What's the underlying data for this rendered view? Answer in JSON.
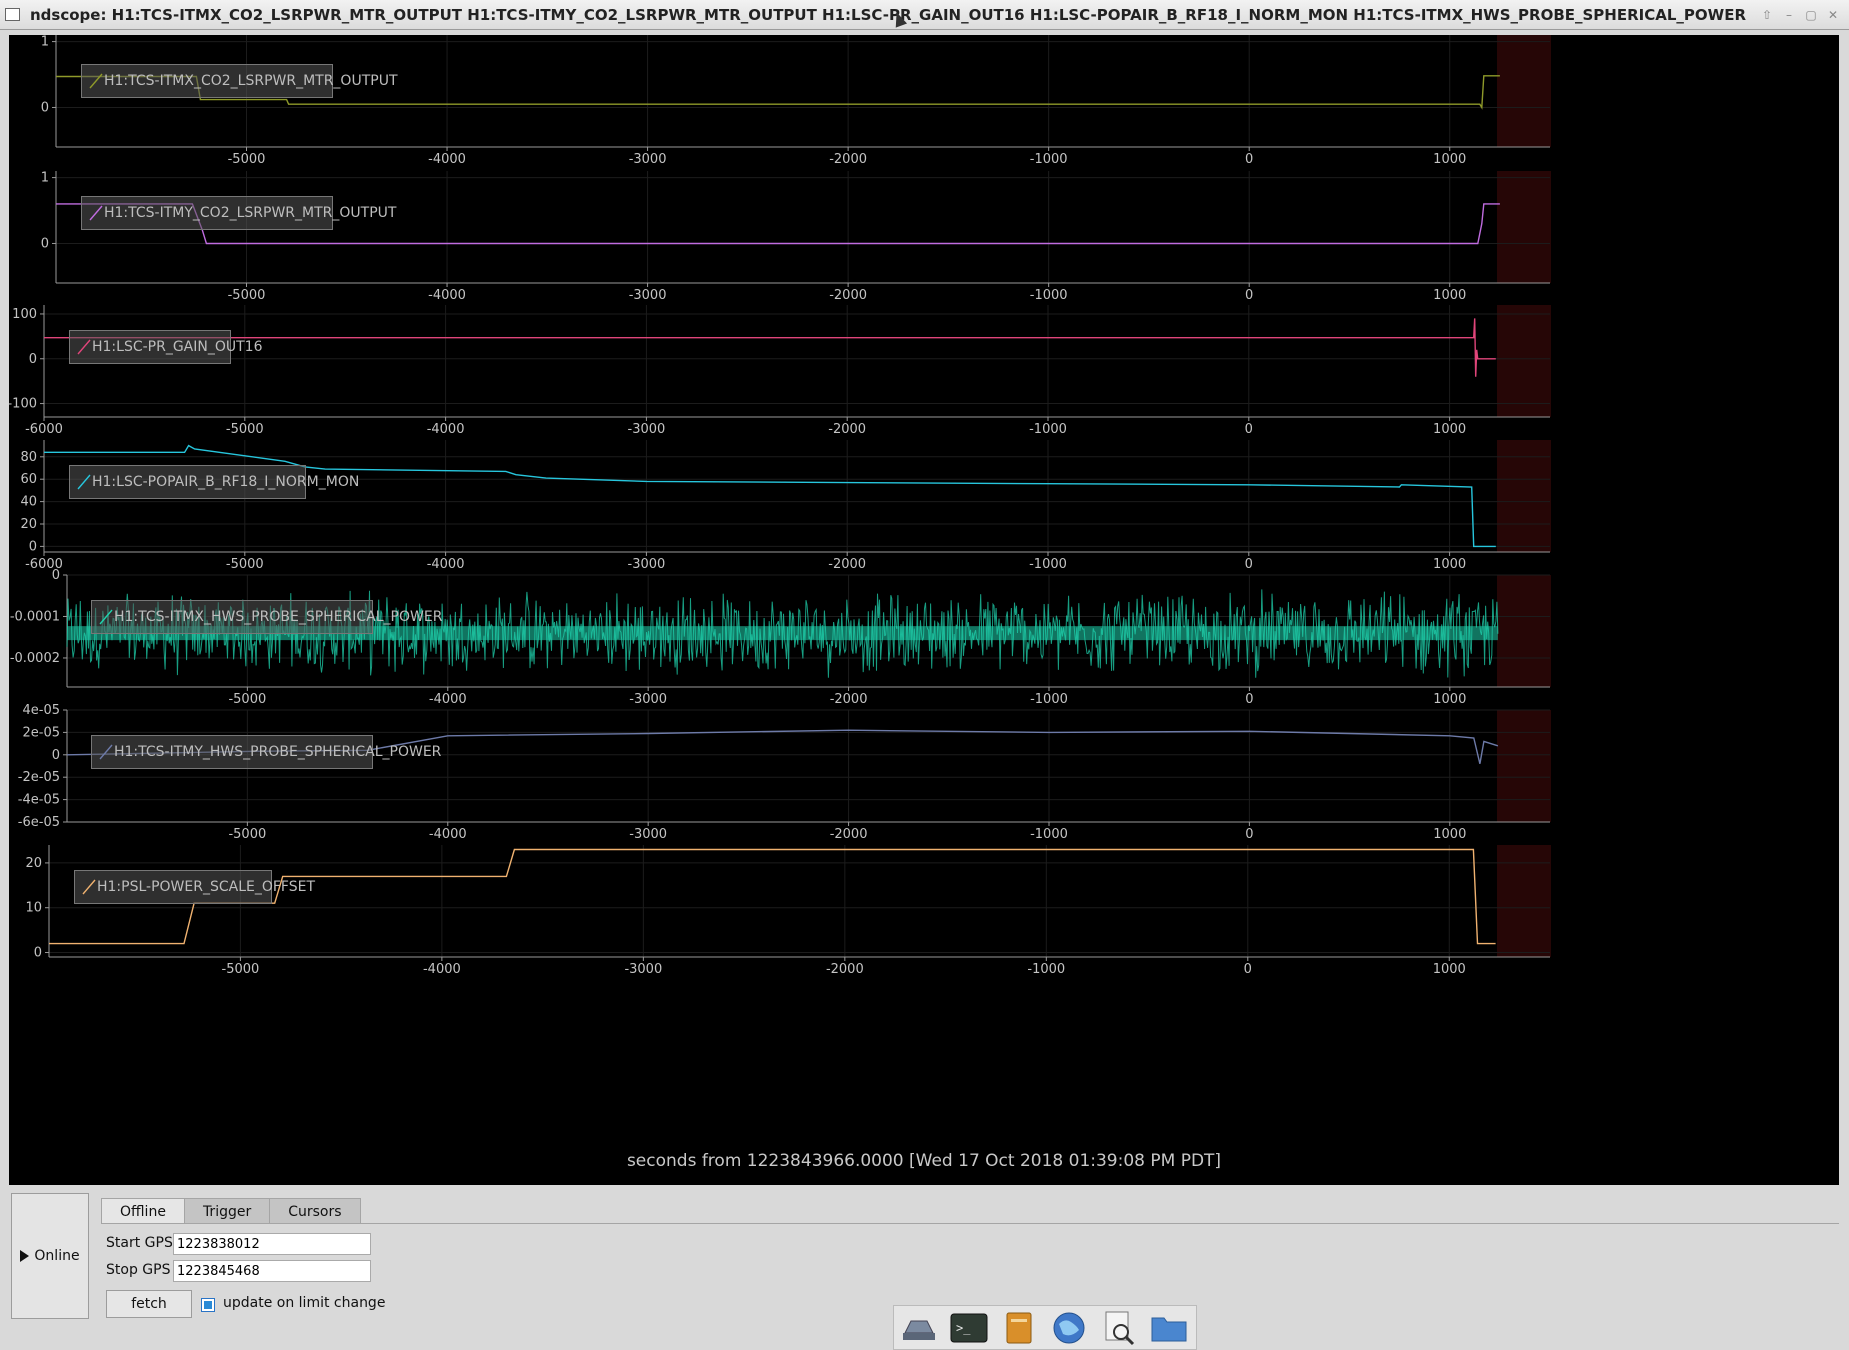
{
  "window": {
    "title": "ndscope: H1:TCS-ITMX_CO2_LSRPWR_MTR_OUTPUT H1:TCS-ITMY_CO2_LSRPWR_MTR_OUTPUT H1:LSC-PR_GAIN_OUT16 H1:LSC-POPAIR_B_RF18_I_NORM_MON H1:TCS-ITMX_HWS_PROBE_SPHERICAL_POWER H1:TCS-ITMY_HWS_PROBE_SPHERICAL_POWER H1:PSL-POWER_SCALE_OFFSET",
    "buttons": [
      "⇧",
      "–",
      "▢",
      "✕"
    ]
  },
  "plot": {
    "x_caption": "seconds from 1223843966.0000 [Wed 17 Oct 2018 01:39:08 PM PDT]"
  },
  "chart_data": [
    {
      "type": "line",
      "series": [
        {
          "name": "H1:TCS-ITMX_CO2_LSRPWR_MTR_OUTPUT",
          "color": "#8f9a2a",
          "x": [
            -5950,
            -5250,
            -5230,
            -4800,
            -4790,
            1150,
            1160,
            1170,
            1230,
            1250
          ],
          "y": [
            0.47,
            0.47,
            0.12,
            0.12,
            0.05,
            0.05,
            0.0,
            0.48,
            0.48,
            0.48
          ]
        }
      ],
      "y_ticks": [
        "1",
        "0"
      ],
      "x_ticks": [
        "-5000",
        "-4000",
        "-3000",
        "-2000",
        "-1000",
        "0",
        "1000"
      ],
      "ylim": [
        -0.6,
        1.1
      ],
      "xlim": [
        -5950,
        1500
      ]
    },
    {
      "type": "line",
      "series": [
        {
          "name": "H1:TCS-ITMY_CO2_LSRPWR_MTR_OUTPUT",
          "color": "#c06ce0",
          "x": [
            -5950,
            -5270,
            -5220,
            -5200,
            1140,
            1160,
            1170,
            1250
          ],
          "y": [
            0.6,
            0.6,
            0.2,
            0.0,
            0.0,
            0.3,
            0.6,
            0.6
          ]
        }
      ],
      "y_ticks": [
        "1",
        "0"
      ],
      "x_ticks": [
        "-5000",
        "-4000",
        "-3000",
        "-2000",
        "-1000",
        "0",
        "1000"
      ],
      "ylim": [
        -0.6,
        1.1
      ],
      "xlim": [
        -5950,
        1500
      ]
    },
    {
      "type": "line",
      "series": [
        {
          "name": "H1:LSC-PR_GAIN_OUT16",
          "color": "#e0457a",
          "x": [
            -6000,
            1120,
            1125,
            1130,
            1135,
            1140,
            1150,
            1230
          ],
          "y": [
            47,
            47,
            90,
            -40,
            20,
            0,
            0,
            0
          ]
        }
      ],
      "y_ticks": [
        "100",
        "0",
        "-100"
      ],
      "x_ticks": [
        "-6000",
        "-5000",
        "-4000",
        "-3000",
        "-2000",
        "-1000",
        "0",
        "1000"
      ],
      "ylim": [
        -130,
        120
      ],
      "xlim": [
        -6000,
        1500
      ]
    },
    {
      "type": "line",
      "series": [
        {
          "name": "H1:LSC-POPAIR_B_RF18_I_NORM_MON",
          "color": "#27c6dd",
          "x": [
            -6000,
            -5300,
            -5280,
            -5250,
            -4800,
            -4700,
            -4600,
            -3700,
            -3650,
            -3500,
            -3000,
            -2000,
            -1000,
            0,
            750,
            760,
            1110,
            1120,
            1230
          ],
          "y": [
            84,
            84,
            90,
            87,
            76,
            71,
            69,
            67,
            64,
            61,
            58,
            57,
            56,
            55,
            53,
            55,
            53,
            0,
            0
          ]
        }
      ],
      "y_ticks": [
        "80",
        "60",
        "40",
        "20",
        "0"
      ],
      "x_ticks": [
        "-6000",
        "-5000",
        "-4000",
        "-3000",
        "-2000",
        "-1000",
        "0",
        "1000"
      ],
      "ylim": [
        -5,
        95
      ],
      "xlim": [
        -6000,
        1500
      ]
    },
    {
      "type": "line",
      "series": [
        {
          "name": "H1:TCS-ITMX_HWS_PROBE_SPHERICAL_POWER",
          "color": "#1fd3ae",
          "x": [
            -5900,
            1240
          ],
          "y_center": -0.00014,
          "y_noise": 0.00011
        }
      ],
      "y_ticks": [
        "0",
        "-0.0001",
        "-0.0002"
      ],
      "x_ticks": [
        "-5000",
        "-4000",
        "-3000",
        "-2000",
        "-1000",
        "0",
        "1000"
      ],
      "ylim": [
        -0.00027,
        0.0
      ],
      "xlim": [
        -5900,
        1500
      ]
    },
    {
      "type": "line",
      "series": [
        {
          "name": "H1:TCS-ITMY_HWS_PROBE_SPHERICAL_POWER",
          "color": "#6d7aa8",
          "x": [
            -5900,
            -5000,
            -4400,
            -4000,
            -3000,
            -2000,
            -1000,
            0,
            1000,
            1120,
            1150,
            1170,
            1240
          ],
          "y": [
            0.0,
            3e-06,
            4e-06,
            1.7e-05,
            1.9e-05,
            2.2e-05,
            2e-05,
            2.1e-05,
            1.7e-05,
            1.5e-05,
            -8e-06,
            1.2e-05,
            8e-06
          ]
        }
      ],
      "y_ticks": [
        "4e-05",
        "2e-05",
        "0",
        "-2e-05",
        "-4e-05",
        "-6e-05"
      ],
      "x_ticks": [
        "-5000",
        "-4000",
        "-3000",
        "-2000",
        "-1000",
        "0",
        "1000"
      ],
      "ylim": [
        -6e-05,
        4e-05
      ],
      "xlim": [
        -5900,
        1500
      ]
    },
    {
      "type": "line",
      "series": [
        {
          "name": "H1:PSL-POWER_SCALE_OFFSET",
          "color": "#f0b270",
          "x": [
            -5950,
            -5280,
            -5230,
            -4830,
            -4790,
            -3680,
            -3640,
            1120,
            1140,
            1230
          ],
          "y": [
            2,
            2,
            11,
            11,
            17,
            17,
            23,
            23,
            2,
            2
          ]
        }
      ],
      "y_ticks": [
        "20",
        "10",
        "0"
      ],
      "x_ticks": [
        "-5000",
        "-4000",
        "-3000",
        "-2000",
        "-1000",
        "0",
        "1000"
      ],
      "ylim": [
        -1,
        24
      ],
      "xlim": [
        -5950,
        1500
      ]
    }
  ],
  "controls": {
    "online_button": "Online",
    "tabs": [
      "Offline",
      "Trigger",
      "Cursors"
    ],
    "start_label": "Start GPS",
    "start_value": "1223838012",
    "stop_label": "Stop GPS",
    "stop_value": "1223845468",
    "fetch_button": "fetch",
    "update_checkbox_label": "update on limit change",
    "update_checked": true
  },
  "taskbar": {
    "icons": [
      "drive-icon",
      "terminal-icon",
      "notes-icon",
      "browser-icon",
      "search-doc-icon",
      "folder-icon"
    ]
  }
}
